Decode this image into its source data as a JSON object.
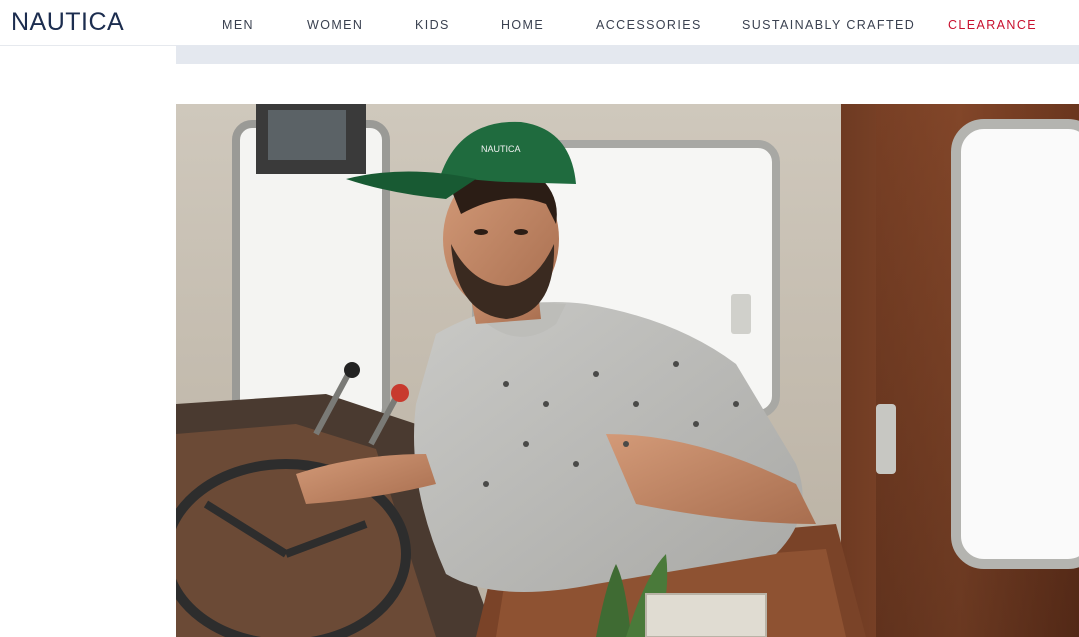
{
  "brand": {
    "logo_text": "NAUTICA",
    "logo_color": "#1c2d4f"
  },
  "nav": {
    "items": [
      {
        "label": "MEN"
      },
      {
        "label": "WOMEN"
      },
      {
        "label": "KIDS"
      },
      {
        "label": "HOME"
      },
      {
        "label": "ACCESSORIES"
      },
      {
        "label": "SUSTAINABLY CRAFTED"
      },
      {
        "label": "CLEARANCE",
        "color": "#c8102e"
      }
    ]
  },
  "hero": {
    "cap_text": "NAUTICA"
  },
  "colors": {
    "banner_band": "#e4e8ef",
    "nav_text": "#3a4150",
    "accent_red": "#c8102e"
  }
}
